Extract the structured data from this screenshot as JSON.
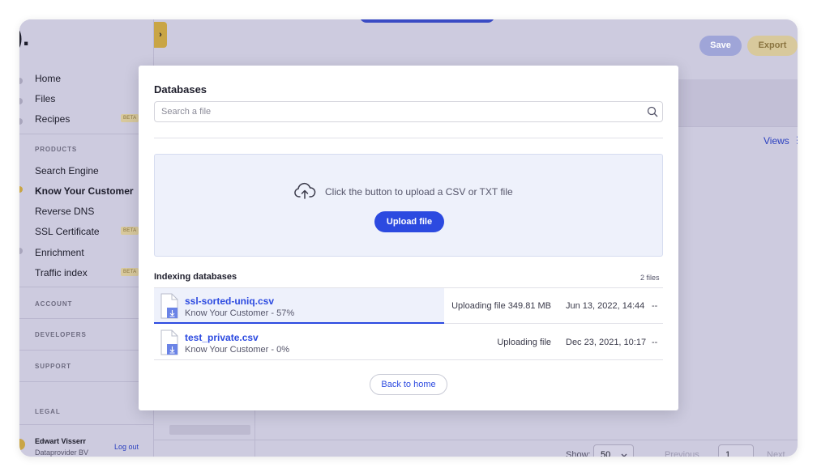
{
  "app": {
    "logo": ").",
    "toolbar": {
      "save_label": "Save",
      "export_label": "Export"
    },
    "collapse_glyph": "›",
    "views_label": "Views",
    "views_menu_glyph": "⋮"
  },
  "sidebar": {
    "top_items": [
      {
        "label": "Home"
      },
      {
        "label": "Files"
      },
      {
        "label": "Recipes",
        "badge": "BETA"
      }
    ],
    "products_section": "PRODUCTS",
    "products": [
      {
        "label": "Search Engine"
      },
      {
        "label": "Know Your Customer",
        "active": true
      },
      {
        "label": "Reverse DNS"
      },
      {
        "label": "SSL Certificate",
        "badge": "BETA"
      },
      {
        "label": "Enrichment"
      },
      {
        "label": "Traffic index",
        "badge": "BETA"
      }
    ],
    "sections": [
      "ACCOUNT",
      "DEVELOPERS",
      "SUPPORT",
      "LEGAL"
    ],
    "user": {
      "name": "Edwart Visserr",
      "company": "Dataprovider BV",
      "logout_label": "Log out"
    }
  },
  "pagination": {
    "show_label": "Show:",
    "page_size": "50",
    "previous_label": "Previous",
    "page": "1",
    "next_label": "Next"
  },
  "modal": {
    "title": "Databases",
    "search_placeholder": "Search a file",
    "dropzone_text": "Click the button to upload a CSV or TXT file",
    "upload_label": "Upload file",
    "indexing_title": "Indexing databases",
    "file_count": "2 files",
    "files": [
      {
        "name": "ssl-sorted-uniq.csv",
        "subtitle": "Know Your Customer - 57%",
        "status": "Uploading file 349.81 MB",
        "date": "Jun 13, 2022, 14:44",
        "more": "--",
        "progress": 0.57
      },
      {
        "name": "test_private.csv",
        "subtitle": "Know Your Customer - 0%",
        "status": "Uploading file",
        "date": "Dec 23, 2021, 10:17",
        "more": "--",
        "progress": 0
      }
    ],
    "back_label": "Back to home"
  },
  "colors": {
    "accent": "#2c4ae0",
    "accent_gold": "#c9a545",
    "overlay": "#cdcbdf",
    "dropzone_bg": "#eef1fb"
  }
}
